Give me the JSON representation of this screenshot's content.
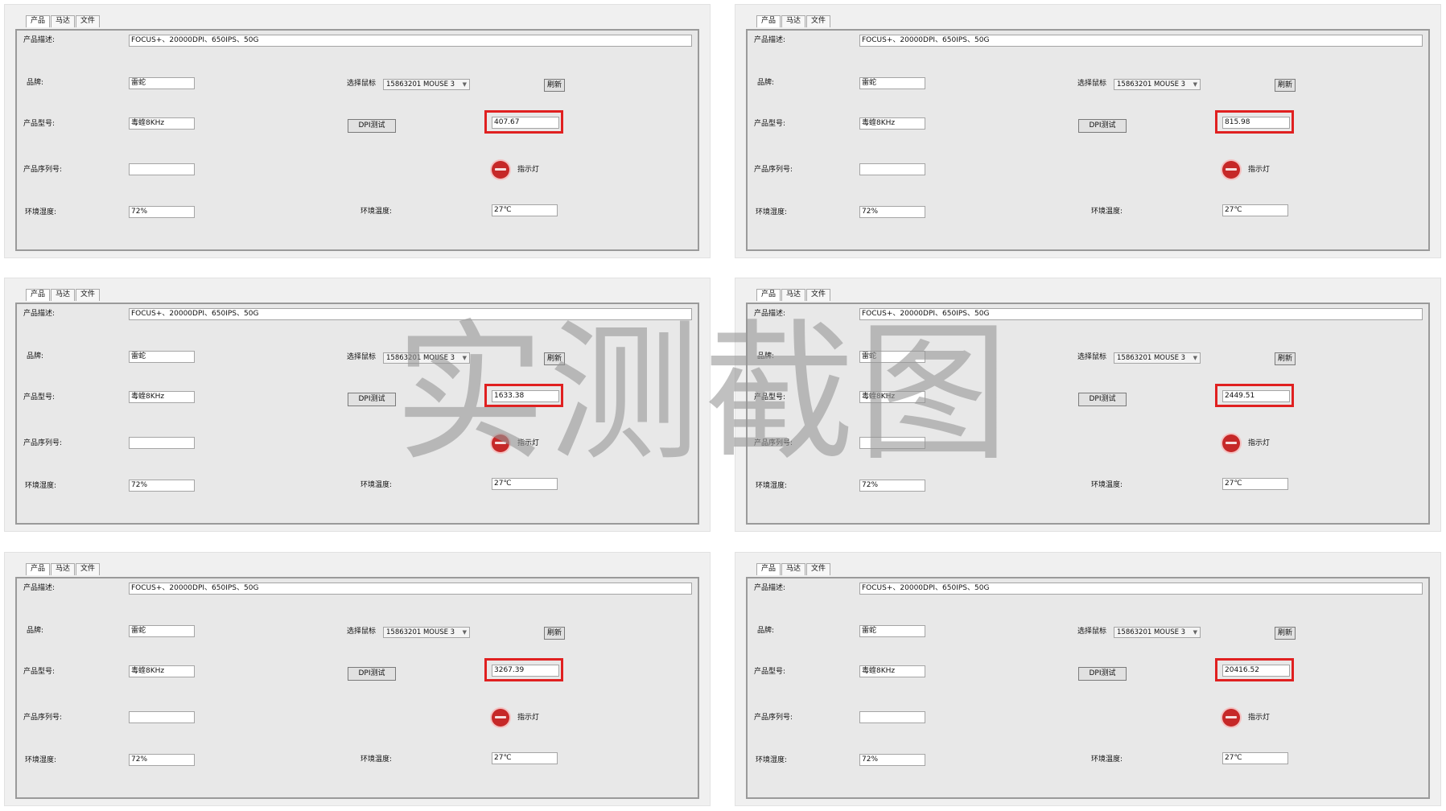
{
  "tabs": [
    "产品",
    "马达",
    "文件"
  ],
  "labels": {
    "description": "产品描述:",
    "brand": "品牌:",
    "select_mouse": "选择鼠标",
    "model": "产品型号:",
    "serial": "产品序列号:",
    "humidity": "环境湿度:",
    "temperature": "环境温度:",
    "indicator": "指示灯",
    "refresh": "刷新",
    "dpi_test": "DPI测试"
  },
  "values": {
    "description": "FOCUS+、20000DPI、650IPS、50G",
    "brand": "雷蛇",
    "mouse": "15863201   MOUSE   3",
    "model": "毒蝰8KHz",
    "serial": "",
    "humidity": "72%",
    "temperature": "27℃"
  },
  "dpi_readings": [
    "407.67",
    "815.98",
    "1633.38",
    "2449.51",
    "3267.39",
    "20416.52"
  ],
  "colors": {
    "highlight": "#e02020",
    "indicator": "#c62828"
  },
  "icons": {
    "dropdown": "chevron-down-icon",
    "indicator": "red-indicator-light-icon"
  },
  "watermark": "实测截图"
}
